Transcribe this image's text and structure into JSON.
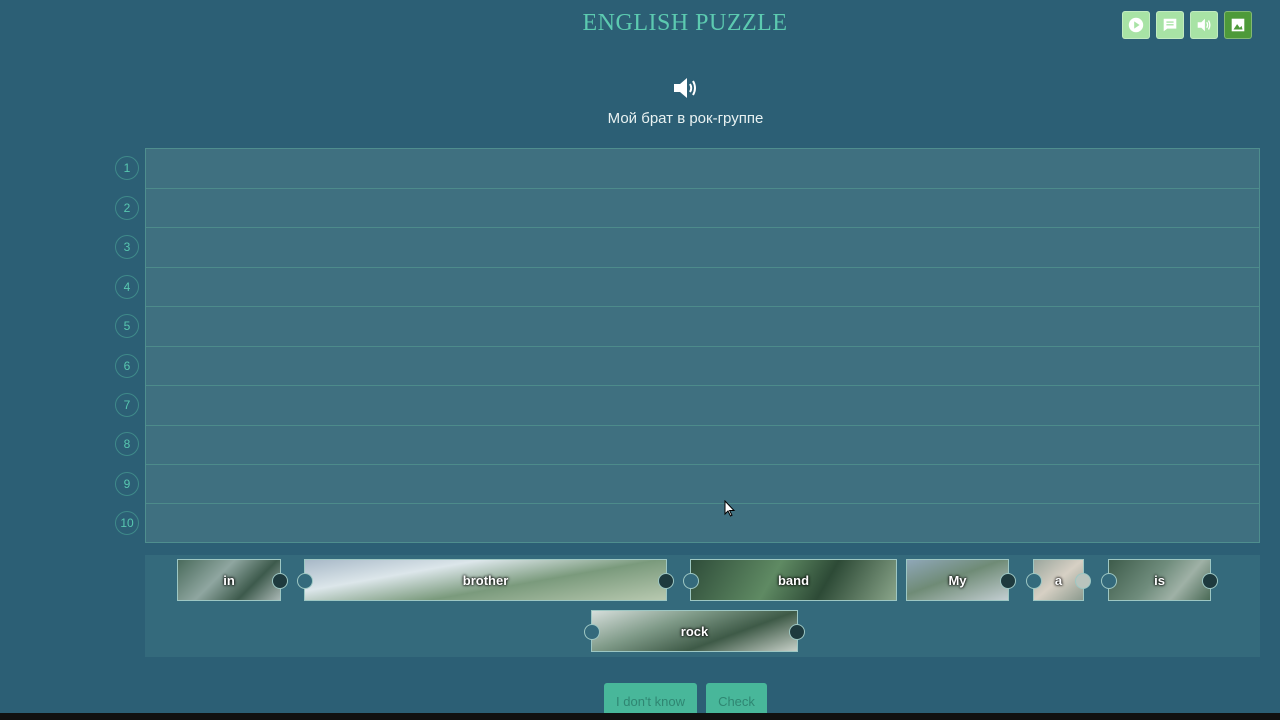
{
  "app": {
    "title": "ENGLISH PUZZLE"
  },
  "toolbar": {
    "buttons": [
      {
        "name": "autoplay",
        "icon": "play-icon",
        "active": false
      },
      {
        "name": "translation",
        "icon": "message-icon",
        "active": false
      },
      {
        "name": "pronunciation",
        "icon": "speaker-icon",
        "active": false
      },
      {
        "name": "background-image",
        "icon": "image-icon",
        "active": true
      }
    ]
  },
  "task": {
    "audio_icon": "speaker-icon",
    "translation": "Мой брат в рок-группе"
  },
  "board": {
    "rows": [
      "1",
      "2",
      "3",
      "4",
      "5",
      "6",
      "7",
      "8",
      "9",
      "10"
    ]
  },
  "pieces": [
    {
      "word": "in"
    },
    {
      "word": "brother"
    },
    {
      "word": "band"
    },
    {
      "word": "My"
    },
    {
      "word": "a"
    },
    {
      "word": "is"
    },
    {
      "word": "rock"
    }
  ],
  "actions": {
    "dont_know_label": "I don't know",
    "check_label": "Check"
  },
  "colors": {
    "background": "#2c5f75",
    "accent": "#5ccab0",
    "button": "#48b79a",
    "toolbar_button": "#a8e3a5",
    "toolbar_button_active": "#4e9a3a"
  }
}
